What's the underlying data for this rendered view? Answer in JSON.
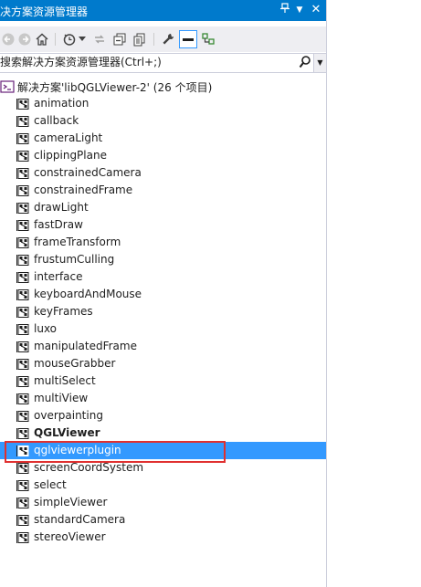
{
  "window": {
    "title": "决方案资源管理器",
    "pin_glyph": "📌",
    "dropdown_glyph": "▼",
    "close_glyph": "✕"
  },
  "toolbar": {
    "icons": [
      "back-icon",
      "forward-icon",
      "home-icon",
      "history-icon",
      "sync-icon",
      "collapse-all-icon",
      "show-all-files-icon",
      "properties-icon",
      "preview-icon",
      "class-view-icon"
    ]
  },
  "search": {
    "placeholder": "搜索解决方案资源管理器(Ctrl+;)"
  },
  "solution": {
    "label": "解决方案'libQGLViewer-2' (26 个项目)"
  },
  "projects": [
    {
      "label": "animation"
    },
    {
      "label": "callback"
    },
    {
      "label": "cameraLight"
    },
    {
      "label": "clippingPlane"
    },
    {
      "label": "constrainedCamera"
    },
    {
      "label": "constrainedFrame"
    },
    {
      "label": "drawLight"
    },
    {
      "label": "fastDraw"
    },
    {
      "label": "frameTransform"
    },
    {
      "label": "frustumCulling"
    },
    {
      "label": "interface"
    },
    {
      "label": "keyboardAndMouse"
    },
    {
      "label": "keyFrames"
    },
    {
      "label": "luxo"
    },
    {
      "label": "manipulatedFrame"
    },
    {
      "label": "mouseGrabber"
    },
    {
      "label": "multiSelect"
    },
    {
      "label": "multiView"
    },
    {
      "label": "overpainting"
    },
    {
      "label": "QGLViewer",
      "bold": true
    },
    {
      "label": "qglviewerplugin",
      "selected": true
    },
    {
      "label": "screenCoordSystem"
    },
    {
      "label": "select"
    },
    {
      "label": "simpleViewer"
    },
    {
      "label": "standardCamera"
    },
    {
      "label": "stereoViewer"
    }
  ],
  "colors": {
    "titlebar": "#007acc",
    "selection": "#3399ff",
    "highlight_box": "#e03030"
  }
}
